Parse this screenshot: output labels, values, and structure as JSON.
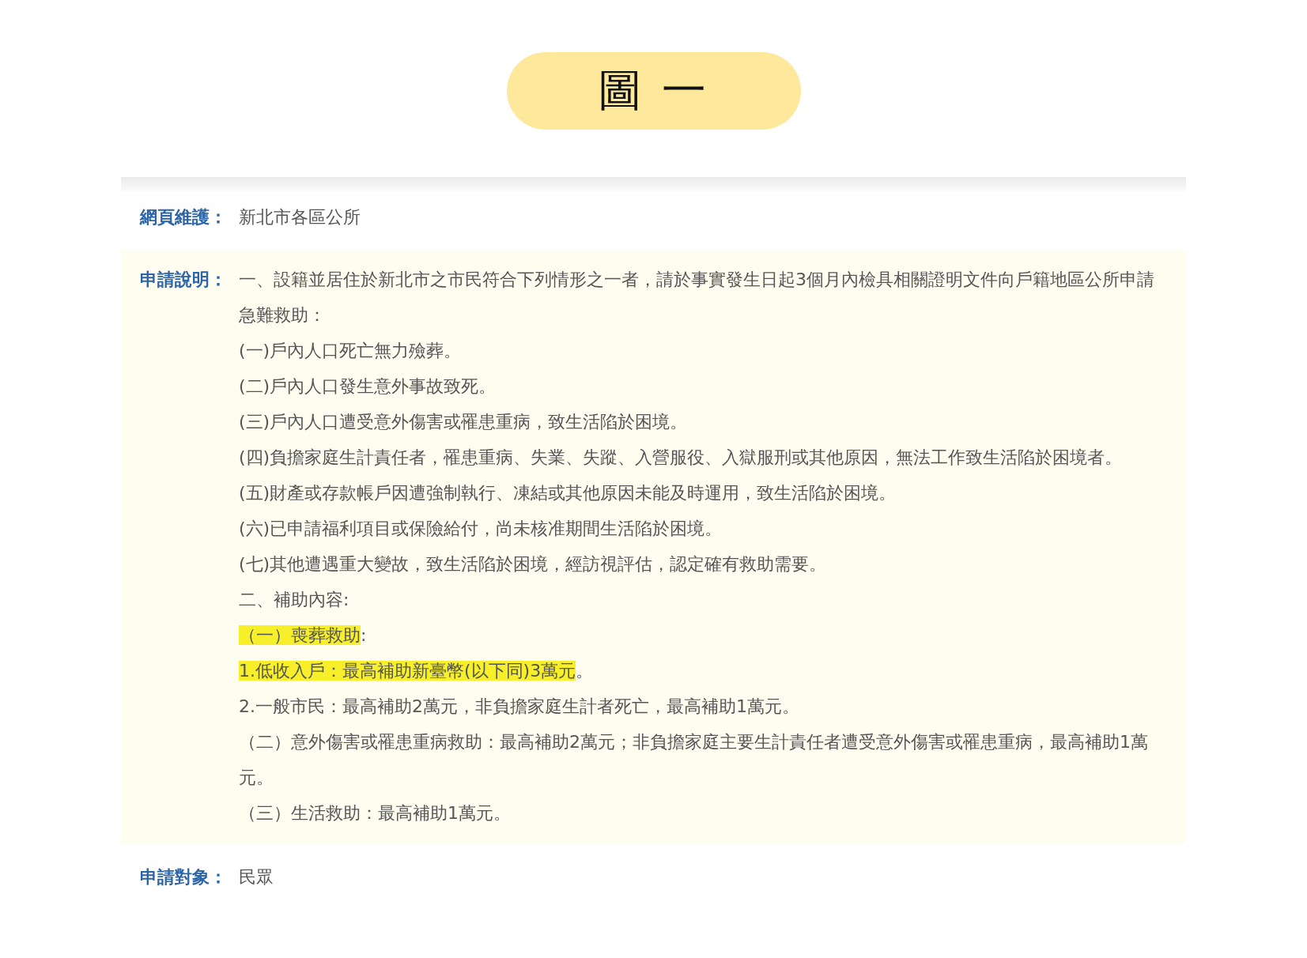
{
  "header": {
    "title": "圖 一"
  },
  "fields": [
    {
      "label": "網頁維護：",
      "shaded": false,
      "paragraphs": [
        {
          "parts": [
            {
              "text": "新北市各區公所",
              "highlighted": false
            }
          ]
        }
      ]
    },
    {
      "label": "申請說明：",
      "shaded": true,
      "paragraphs": [
        {
          "parts": [
            {
              "text": "一、設籍並居住於新北市之市民符合下列情形之一者，請於事實發生日起3個月內檢具相關證明文件向戶籍地區公所申請急難救助：",
              "highlighted": false
            }
          ]
        },
        {
          "parts": [
            {
              "text": "(一)戶內人口死亡無力殮葬。",
              "highlighted": false
            }
          ]
        },
        {
          "parts": [
            {
              "text": "(二)戶內人口發生意外事故致死。",
              "highlighted": false
            }
          ]
        },
        {
          "parts": [
            {
              "text": "(三)戶內人口遭受意外傷害或罹患重病，致生活陷於困境。",
              "highlighted": false
            }
          ]
        },
        {
          "parts": [
            {
              "text": "(四)負擔家庭生計責任者，罹患重病、失業、失蹤、入營服役、入獄服刑或其他原因，無法工作致生活陷於困境者。",
              "highlighted": false
            }
          ]
        },
        {
          "parts": [
            {
              "text": "(五)財產或存款帳戶因遭強制執行、凍結或其他原因未能及時運用，致生活陷於困境。",
              "highlighted": false
            }
          ]
        },
        {
          "parts": [
            {
              "text": "(六)已申請福利項目或保險給付，尚未核准期間生活陷於困境。",
              "highlighted": false
            }
          ]
        },
        {
          "parts": [
            {
              "text": "(七)其他遭遇重大變故，致生活陷於困境，經訪視評估，認定確有救助需要。",
              "highlighted": false
            }
          ]
        },
        {
          "parts": [
            {
              "text": "二、補助內容:",
              "highlighted": false
            }
          ]
        },
        {
          "parts": [
            {
              "text": "（一）喪葬救助",
              "highlighted": true
            },
            {
              "text": ":",
              "highlighted": false
            }
          ]
        },
        {
          "parts": [
            {
              "text": "1.低收入戶：最高補助新臺幣(以下同)3萬元",
              "highlighted": true
            },
            {
              "text": "。",
              "highlighted": false
            }
          ]
        },
        {
          "parts": [
            {
              "text": "2.一般市民：最高補助2萬元，非負擔家庭生計者死亡，最高補助1萬元。",
              "highlighted": false
            }
          ]
        },
        {
          "parts": [
            {
              "text": "（二）意外傷害或罹患重病救助：最高補助2萬元；非負擔家庭主要生計責任者遭受意外傷害或罹患重病，最高補助1萬元。",
              "highlighted": false
            }
          ]
        },
        {
          "parts": [
            {
              "text": "（三）生活救助：最高補助1萬元。",
              "highlighted": false
            }
          ]
        }
      ]
    },
    {
      "label": "申請對象：",
      "shaded": false,
      "paragraphs": [
        {
          "parts": [
            {
              "text": "民眾",
              "highlighted": false
            }
          ]
        }
      ]
    }
  ]
}
